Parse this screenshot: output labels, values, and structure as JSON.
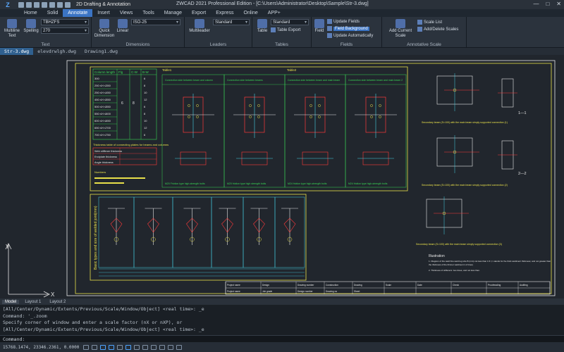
{
  "titlebar": {
    "logo": "Z",
    "workspace": "2D Drafting & Annotation",
    "title": "ZWCAD 2021 Professional Edition - [C:\\Users\\Administrator\\Desktop\\Sample\\Str-3.dwg]",
    "controls": [
      "—",
      "□",
      "✕"
    ]
  },
  "menu": [
    "Home",
    "Solid",
    "Annotate",
    "Insert",
    "Views",
    "Tools",
    "Manage",
    "Export",
    "Express",
    "Online",
    "APP+"
  ],
  "menu_active": "Annotate",
  "ribbon": {
    "text_panel": {
      "label": "Text",
      "multiline": "Multiline Text",
      "spelling": "Spelling",
      "style": "TBHZFS",
      "height": "270"
    },
    "dim_panel": {
      "label": "Dimensions",
      "quick": "Quick Dimension",
      "linear": "Linear",
      "style": "ISO-25"
    },
    "leaders_panel": {
      "label": "Leaders",
      "multileader": "Multileader",
      "style": "Standard"
    },
    "tables_panel": {
      "label": "Tables",
      "table": "Table",
      "style": "Standard",
      "export": "Table Export"
    },
    "fields_panel": {
      "label": "Fields",
      "field": "Field",
      "update": "Update Fields",
      "bg": "Field Background",
      "auto": "Update Automatically"
    },
    "scale_panel": {
      "label": "Annotative Scale",
      "add": "Add Current Scale",
      "list": "Scale List",
      "adddel": "Add/Delete Scales"
    }
  },
  "doctabs": [
    "Str-3.dwg",
    "elevdrwlgh.dwg",
    "Drawing1.dwg"
  ],
  "drawing": {
    "table1_headers": [
      "Column length",
      "Flg",
      "C-W",
      "B-W"
    ],
    "table1_rows": [
      "300",
      "250 ≤H ≤350",
      "250 ≤H ≤450",
      "450 ≤H ≤550",
      "500 ≤H ≤550",
      "550 ≤H ≤600",
      "600 ≤H ≤650",
      "650 ≤H ≤700",
      "700 ≤H ≤750"
    ],
    "table1_vals": [
      "6",
      "8",
      "10",
      "12"
    ],
    "table1_mid": [
      "6",
      "8"
    ],
    "sections": [
      "Table1",
      "Table2"
    ],
    "conn_titles": [
      "Connection side between beam and column",
      "Connection side between beams",
      "Connection side between beam and main beam",
      "Connection side between beam and main beam 2"
    ],
    "conn_notes": [
      "M20 Friction type high-strength bolts",
      "M20 friction type high strength bolts",
      "M24 friction type high-strength bolts",
      "M24 friction type high-strength bolts"
    ],
    "thick_title": "Thickness table of connecting plates for beams and columns",
    "thick_rows": [
      "Web stiffener thickness",
      "Endplate thickness",
      "Angle thickness"
    ],
    "numbers_label": "Numbers",
    "bottom_title": "Basic types and size of welded joint(mm)",
    "sect_labels": [
      "1—1",
      "2—2"
    ],
    "sect_notes": [
      "Secondary beam (S=100) with the main beam simply supported connection (1)",
      "Secondary beam (S=100) with the main beam simply supported connection (2)",
      "Secondary beam (S=100) with the main beam simply supported connection (3)"
    ],
    "illus_title": "Illustration",
    "illus_lines": [
      "1. Diagram of the weld fine weld leg size B (mm) not less than 1.5 t; t stands for the thick weldment thickness; and not greater than",
      "the thickness of the thinner weldment 1.2 times;",
      "2. Thickness of stiffeners: two times, and not less than."
    ],
    "titleblock": [
      "Project name",
      "Design",
      "Drawing number",
      "Construction",
      "Drawing",
      "Scale",
      "Date",
      "Check",
      "Proofreading",
      "Auditing",
      "Project name",
      "Job grade",
      "Design number",
      "Drawing no",
      "Sheet"
    ]
  },
  "ucs": {
    "y": "Y",
    "x": "X"
  },
  "layout_tabs": [
    "Model",
    "Layout 1",
    "Layout 2"
  ],
  "command_history": [
    "[All/Center/Dynamic/Extents/Previous/Scale/Window/Object] <real time>: _e",
    "Command: '_.zoom",
    "Specify corner of window and enter a scale factor (nX or nXP), or",
    "[All/Center/Dynamic/Extents/Previous/Scale/Window/Object] <real time>: _e"
  ],
  "command_prompt": "Command:",
  "coords": "15768.1474, 23346.2361, 0.0000",
  "colors": {
    "frame": "#e8e04a",
    "green": "#38d654",
    "cyan": "#45d2e6",
    "red": "#ff3a3a",
    "white": "#e8e8e8",
    "accent": "#3b74c4"
  }
}
